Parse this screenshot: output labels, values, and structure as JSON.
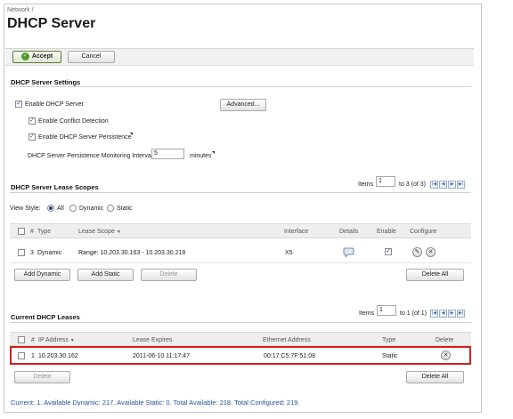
{
  "breadcrumb": "Network /",
  "page_title": "DHCP Server",
  "toolbar": {
    "accept": "Accept",
    "cancel": "Cancel"
  },
  "settings": {
    "heading": "DHCP Server Settings",
    "enable_dhcp": "Enable DHCP Server",
    "advanced": "Advanced...",
    "conflict": "Enable Conflict Detection",
    "persistence": "Enable DHCP Server Persistence",
    "interval_label": "DHCP Server Persistence Monitoring Interval:",
    "interval_value": "5",
    "interval_unit": "minutes"
  },
  "scopes": {
    "heading": "DHCP Server Lease Scopes",
    "items_label": "Items",
    "items_value": "1",
    "items_range": "to 3 (of 3)",
    "view_style_label": "View Style:",
    "view_all": "All",
    "view_dynamic": "Dynamic",
    "view_static": "Static",
    "columns": {
      "num": "#",
      "type": "Type",
      "lease_scope": "Lease Scope",
      "interface": "Interface",
      "details": "Details",
      "enable": "Enable",
      "configure": "Configure"
    },
    "row": {
      "num": "3",
      "type": "Dynamic",
      "scope": "Range: 10.203.30.163 - 10.203.30.218",
      "interface": "X5"
    },
    "add_dynamic": "Add Dynamic",
    "add_static": "Add Static",
    "delete": "Delete",
    "delete_all": "Delete All"
  },
  "leases": {
    "heading": "Current DHCP Leases",
    "items_label": "Items",
    "items_value": "1",
    "items_range": "to 1 (of 1)",
    "columns": {
      "num": "#",
      "ip": "IP Address",
      "expires": "Lease Expires",
      "mac": "Ethernet Address",
      "type": "Type",
      "delete": "Delete"
    },
    "row": {
      "num": "1",
      "ip": "10.203.30.162",
      "expires": "2011-06-10 11:17:47",
      "mac": "00:17:C5:7F:51:08",
      "type": "Static"
    },
    "delete": "Delete",
    "delete_all": "Delete All"
  },
  "footer": "Current: 1. Available Dynamic: 217. Available Static: 0. Total Available: 218. Total Configured: 219.",
  "colors": {
    "accent": "#1f4f9c",
    "highlight": "#d11f1f",
    "accept_green": "#4e9a29"
  },
  "icons": {
    "accept": "check-circle-icon",
    "details": "comment-icon",
    "edit": "pencil-icon",
    "remove": "x-circle-icon",
    "sort": "triangle-down-icon",
    "pager": "pager-arrow-icons"
  }
}
